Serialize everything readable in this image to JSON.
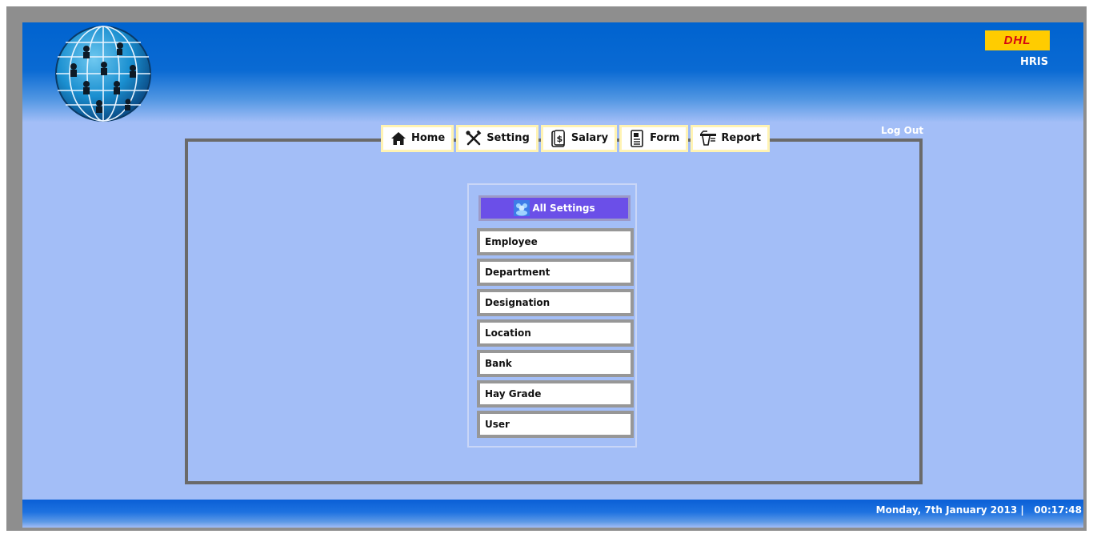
{
  "header": {
    "brand_logo_text": "DHL",
    "app_name": "HRIS",
    "logout_label": "Log Out"
  },
  "nav": {
    "items": [
      {
        "label": "Home",
        "icon": "home-icon"
      },
      {
        "label": "Setting",
        "icon": "tools-icon"
      },
      {
        "label": "Salary",
        "icon": "salary-icon"
      },
      {
        "label": "Form",
        "icon": "form-icon"
      },
      {
        "label": "Report",
        "icon": "report-icon"
      }
    ]
  },
  "panel": {
    "title": "All Settings",
    "title_icon": "settings-group-icon",
    "items": [
      {
        "label": "Employee"
      },
      {
        "label": "Department"
      },
      {
        "label": "Designation"
      },
      {
        "label": "Location"
      },
      {
        "label": "Bank"
      },
      {
        "label": "Hay Grade"
      },
      {
        "label": "User"
      }
    ]
  },
  "footer": {
    "date_time": "Monday, 7th January 2013 |   00:17:48"
  },
  "colors": {
    "header_blue": "#0063cf",
    "background": "#a3bef7",
    "brand_yellow": "#ffcc00",
    "brand_red": "#d40511",
    "panel_header": "#6b4fe8"
  }
}
